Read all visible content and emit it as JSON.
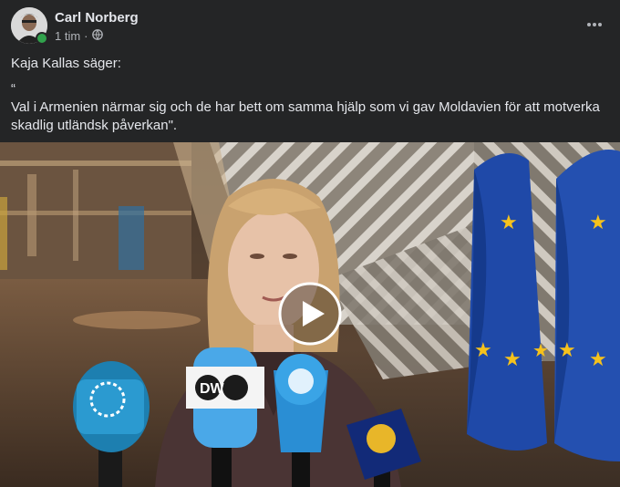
{
  "post": {
    "author": "Carl Norberg",
    "time": "1 tim",
    "separator": "·",
    "text": {
      "line1": "Kaja Kallas säger:",
      "line2": "“",
      "line3": "Val i Armenien närmar sig och de har bett om samma hjälp som vi gav Moldavien för att motverka skadlig utländsk påverkan\"."
    }
  },
  "video": {
    "mic_labels": {
      "dw": "DW"
    }
  },
  "icons": {
    "audience": "globe-icon",
    "menu": "more-options-icon",
    "play": "play-icon"
  },
  "colors": {
    "background": "#242526",
    "text_primary": "#e4e6eb",
    "text_secondary": "#b0b3b8",
    "online": "#31a24c",
    "eu_flag": "#1f49a8",
    "eu_star": "#f6c21c"
  }
}
